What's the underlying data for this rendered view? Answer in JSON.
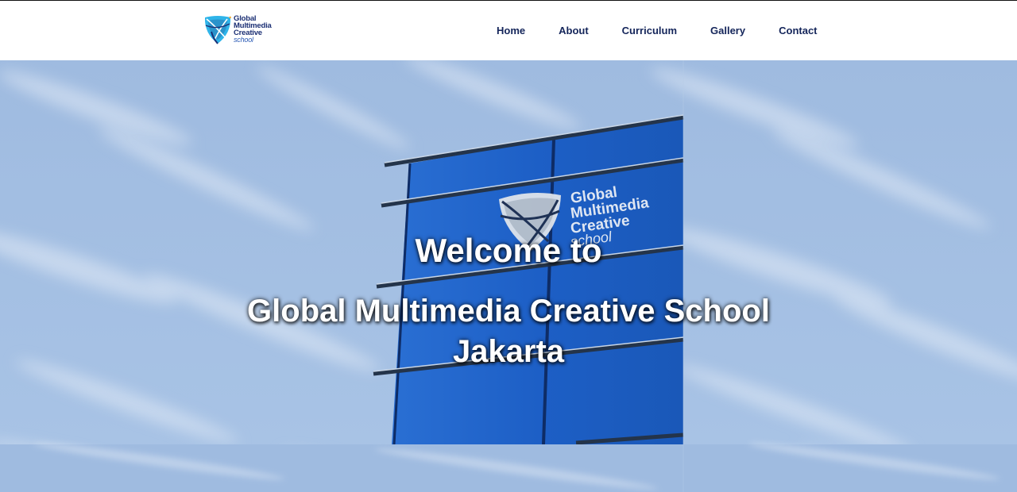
{
  "header": {
    "logo": {
      "line1": "Global",
      "line2": "Multimedia",
      "line3": "Creative",
      "line4": "school"
    },
    "nav": [
      {
        "label": "Home"
      },
      {
        "label": "About"
      },
      {
        "label": "Curriculum"
      },
      {
        "label": "Gallery"
      },
      {
        "label": "Contact"
      }
    ]
  },
  "hero": {
    "welcome": "Welcome to",
    "school_line1": "Global Multimedia Creative School",
    "school_line2": "Jakarta",
    "building_sign": {
      "line1": "Global",
      "line2": "Multimedia",
      "line3": "Creative",
      "line4": "school"
    }
  },
  "colors": {
    "nav_text": "#14255a",
    "logo_blue": "#1b2f74",
    "logo_cyan": "#2fb4e9",
    "sky": "#a6c0e0",
    "glass": "#1f5fc4"
  }
}
